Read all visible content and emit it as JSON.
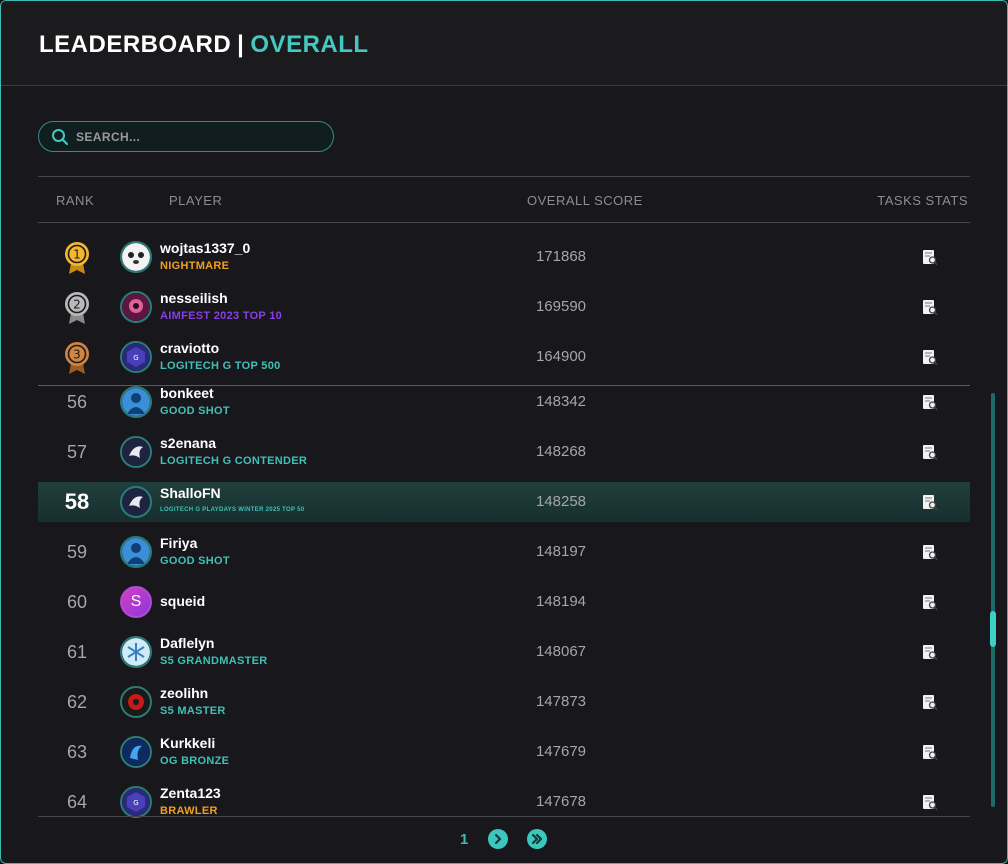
{
  "header": {
    "title_main": "LEADERBOARD",
    "separator": "|",
    "title_accent": "OVERALL"
  },
  "search": {
    "placeholder": "SEARCH..."
  },
  "columns": {
    "rank": "RANK",
    "player": "PLAYER",
    "score": "OVERALL SCORE",
    "stats": "TASKS STATS"
  },
  "colors": {
    "accent": "#45c8c0",
    "gold": "#f0a828",
    "silver": "#a0a0a0",
    "bronze": "#c07032",
    "purple_tag": "#8b3ee8",
    "teal_tag": "#3fc0b8",
    "orange_tag": "#f0a020"
  },
  "top3": [
    {
      "rank": "1",
      "medal": "gold-medal-icon",
      "name": "wojtas1337_0",
      "tag": "NIGHTMARE",
      "tag_color": "#f0a020",
      "score": "171868",
      "avatar": "panda-avatar"
    },
    {
      "rank": "2",
      "medal": "silver-medal-icon",
      "name": "nesseilish",
      "tag": "AIMFEST 2023 TOP 10",
      "tag_color": "#8b3ee8",
      "score": "169590",
      "avatar": "pink-character-avatar"
    },
    {
      "rank": "3",
      "medal": "bronze-medal-icon",
      "name": "craviotto",
      "tag": "LOGITECH G TOP 500",
      "tag_color": "#3fc0b8",
      "score": "164900",
      "avatar": "logitech-badge-avatar"
    }
  ],
  "rows": [
    {
      "rank": "56",
      "name": "bonkeet",
      "tag": "GOOD SHOT",
      "tag_color": "#3fc0b8",
      "score": "148342",
      "avatar": "blue-silhouette-avatar"
    },
    {
      "rank": "57",
      "name": "s2enana",
      "tag": "LOGITECH G CONTENDER",
      "tag_color": "#3fc0b8",
      "score": "148268",
      "avatar": "bird-avatar"
    },
    {
      "rank": "58",
      "name": "ShalloFN",
      "tag": "LOGITECH G PLAYDAYS WINTER 2025 TOP 50",
      "tag_color": "#3fc0b8",
      "score": "148258",
      "avatar": "bird-avatar",
      "highlight": true
    },
    {
      "rank": "59",
      "name": "Firiya",
      "tag": "GOOD SHOT",
      "tag_color": "#3fc0b8",
      "score": "148197",
      "avatar": "blue-silhouette-avatar"
    },
    {
      "rank": "60",
      "name": "squeid",
      "tag": "",
      "tag_color": "#3fc0b8",
      "score": "148194",
      "avatar": "letter-avatar",
      "letter": "S"
    },
    {
      "rank": "61",
      "name": "Daflelyn",
      "tag": "S5 GRANDMASTER",
      "tag_color": "#3fc0b8",
      "score": "148067",
      "avatar": "snowflake-avatar"
    },
    {
      "rank": "62",
      "name": "zeolihn",
      "tag": "S5 MASTER",
      "tag_color": "#3fc0b8",
      "score": "147873",
      "avatar": "red-emblem-avatar"
    },
    {
      "rank": "63",
      "name": "Kurkkeli",
      "tag": "OG BRONZE",
      "tag_color": "#3fc0b8",
      "score": "147679",
      "avatar": "blue-swirl-avatar"
    },
    {
      "rank": "64",
      "name": "Zenta123",
      "tag": "BRAWLER",
      "tag_color": "#f0a020",
      "score": "147678",
      "avatar": "logitech-badge-avatar"
    }
  ],
  "pagination": {
    "current_page": "1"
  }
}
